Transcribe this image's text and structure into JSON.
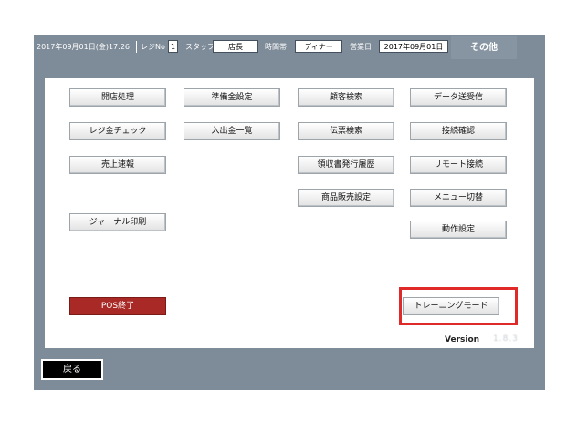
{
  "header": {
    "datetime": "2017年09月01日(金)17:26",
    "register_label": "レジNo",
    "register_no": "1",
    "staff_label": "スタッフ",
    "staff_value": "店長",
    "timeslot_label": "時間帯",
    "timeslot_value": "ディナー",
    "business_date_label": "営業日",
    "business_date_value": "2017年09月01日",
    "other_label": "その他"
  },
  "buttons": {
    "store_open": "開店処理",
    "reserve_setup": "準備金設定",
    "customer_search": "顧客検索",
    "data_transfer": "データ送受信",
    "register_check": "レジ金チェック",
    "cash_inout_list": "入出金一覧",
    "slip_search": "伝票検索",
    "connection_check": "接続確認",
    "sales_report": "売上速報",
    "receipt_history": "領収書発行履歴",
    "remote_connect": "リモート接続",
    "product_sales_setup": "商品販売設定",
    "menu_switch": "メニュー切替",
    "journal_print": "ジャーナル印刷",
    "operation_setup": "動作設定",
    "pos_exit": "POS終了",
    "training_mode": "トレーニングモード"
  },
  "version": {
    "label": "Version",
    "value": "1.8.3"
  },
  "footer": {
    "back_label": "戻る"
  },
  "colors": {
    "frame": "#7e8b98",
    "pos_exit": "#a82925",
    "highlight": "#e02a2a"
  }
}
